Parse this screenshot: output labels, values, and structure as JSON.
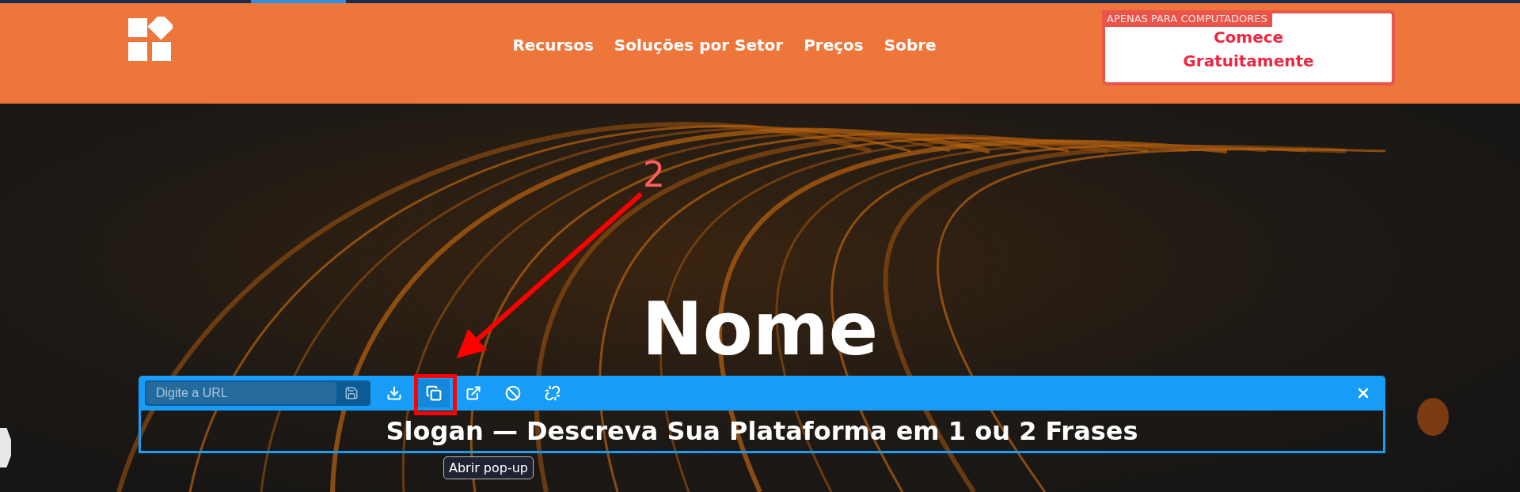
{
  "header": {
    "nav": [
      {
        "label": "Recursos"
      },
      {
        "label": "Soluções por Setor"
      },
      {
        "label": "Preços"
      },
      {
        "label": "Sobre"
      }
    ],
    "cta": {
      "badge": "APENAS PARA COMPUTADORES",
      "label": "Comece Gratuitamente"
    }
  },
  "hero": {
    "title": "Nome",
    "slogan": "Slogan — Descreva Sua Plataforma em 1 ou 2 Frases"
  },
  "editor_toolbar": {
    "url_placeholder": "Digite a URL",
    "tools": [
      {
        "kind": "download",
        "hovered": false
      },
      {
        "kind": "popup",
        "hovered": true
      },
      {
        "kind": "external",
        "hovered": false
      },
      {
        "kind": "block",
        "hovered": false
      },
      {
        "kind": "unlink",
        "hovered": false
      }
    ],
    "tooltip": "Abrir pop-up"
  },
  "annotation": {
    "label": "2"
  }
}
